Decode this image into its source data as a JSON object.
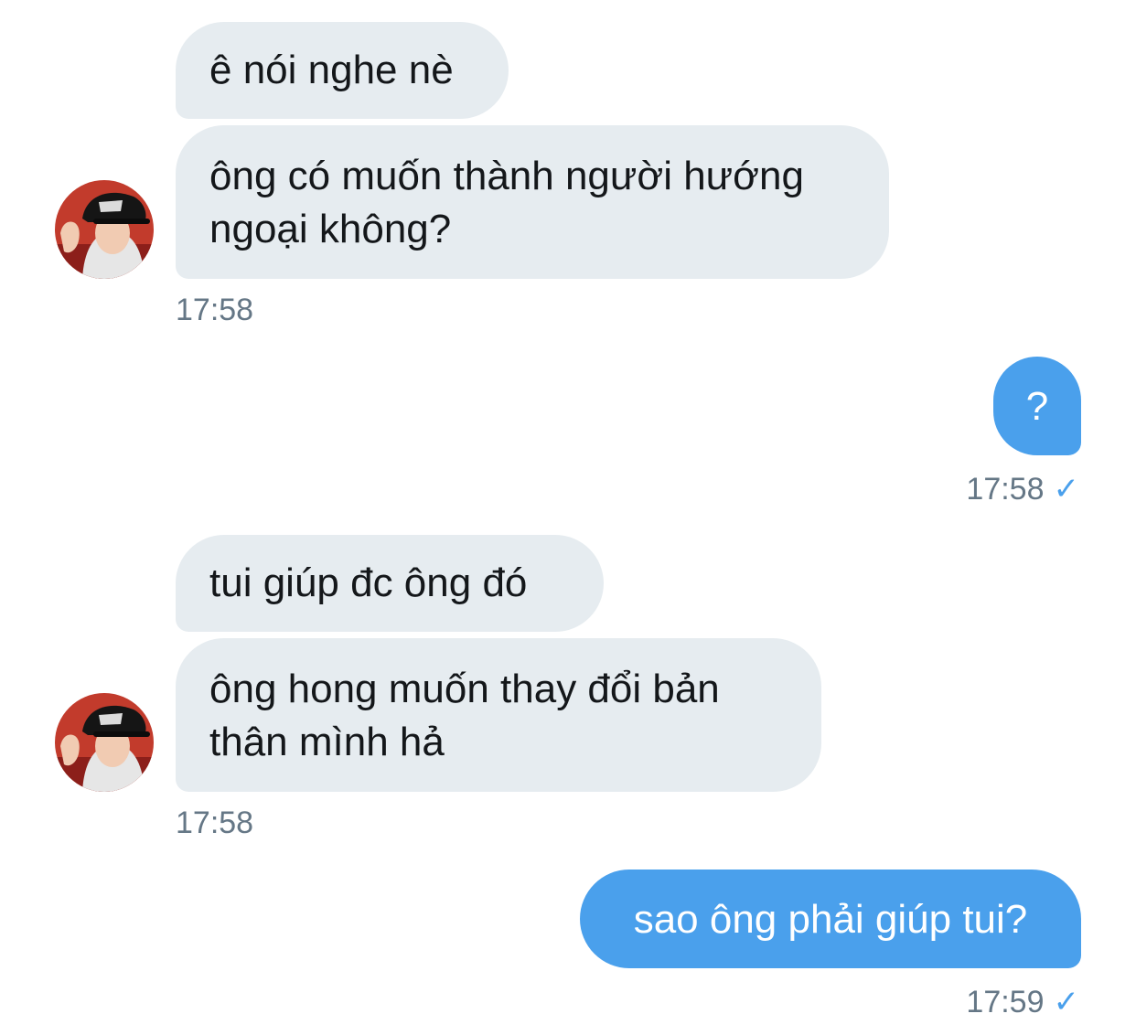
{
  "conversation": {
    "groups": [
      {
        "messages": [
          {
            "text": "ê nói nghe nè"
          },
          {
            "text": "ông có muốn thành người hướng ngoại không?"
          }
        ],
        "time": "17:58"
      },
      {
        "messages": [
          {
            "text": "?"
          }
        ],
        "time": "17:58",
        "status_icon": "checkmark-icon"
      },
      {
        "messages": [
          {
            "text": "tui giúp đc ông đó"
          },
          {
            "text": "ông hong muốn thay đổi bản thân mình hả"
          }
        ],
        "time": "17:58"
      },
      {
        "messages": [
          {
            "text": "sao ông phải giúp tui?"
          }
        ],
        "time": "17:59",
        "status_icon": "checkmark-icon"
      }
    ]
  },
  "colors": {
    "incoming_bubble": "#e6ecf0",
    "outgoing_bubble": "#4aa0ec",
    "timestamp": "#657786",
    "read_check": "#4aa0ec"
  }
}
